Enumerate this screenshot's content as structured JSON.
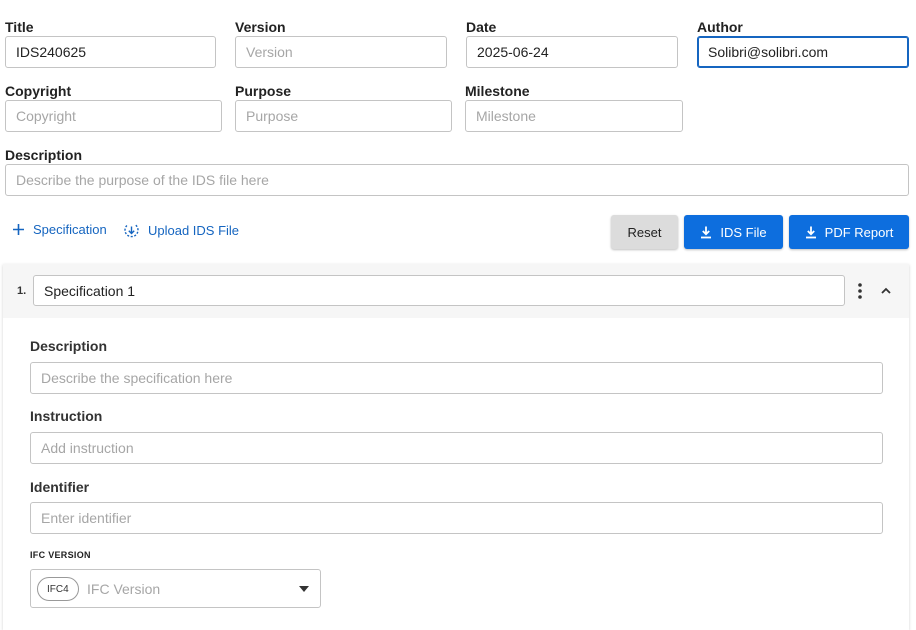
{
  "header_fields": {
    "title": {
      "label": "Title",
      "value": "IDS240625",
      "placeholder": ""
    },
    "version": {
      "label": "Version",
      "value": "",
      "placeholder": "Version"
    },
    "date": {
      "label": "Date",
      "value": "2025-06-24",
      "placeholder": ""
    },
    "author": {
      "label": "Author",
      "value": "Solibri@solibri.com",
      "placeholder": ""
    },
    "copyright": {
      "label": "Copyright",
      "value": "",
      "placeholder": "Copyright"
    },
    "purpose": {
      "label": "Purpose",
      "value": "",
      "placeholder": "Purpose"
    },
    "milestone": {
      "label": "Milestone",
      "value": "",
      "placeholder": "Milestone"
    },
    "description": {
      "label": "Description",
      "value": "",
      "placeholder": "Describe the purpose of the IDS file here"
    }
  },
  "toolbar": {
    "add_specification": "Specification",
    "upload_ids": "Upload IDS File",
    "reset": "Reset",
    "ids_file": "IDS File",
    "pdf_report": "PDF Report"
  },
  "specification": {
    "number": "1.",
    "name": "Specification 1",
    "description": {
      "label": "Description",
      "placeholder": "Describe the specification here"
    },
    "instruction": {
      "label": "Instruction",
      "placeholder": "Add instruction"
    },
    "identifier": {
      "label": "Identifier",
      "placeholder": "Enter identifier"
    },
    "ifc_version": {
      "label": "IFC VERSION",
      "chip": "IFC4",
      "placeholder": "IFC Version"
    }
  },
  "colors": {
    "accent": "#0d6ede",
    "link": "#1565c0",
    "focus_border": "#1565c0"
  },
  "icons": [
    "plus-icon",
    "upload-icon",
    "download-icon",
    "more-vert-icon",
    "chevron-up-icon",
    "dropdown-arrow-icon"
  ]
}
